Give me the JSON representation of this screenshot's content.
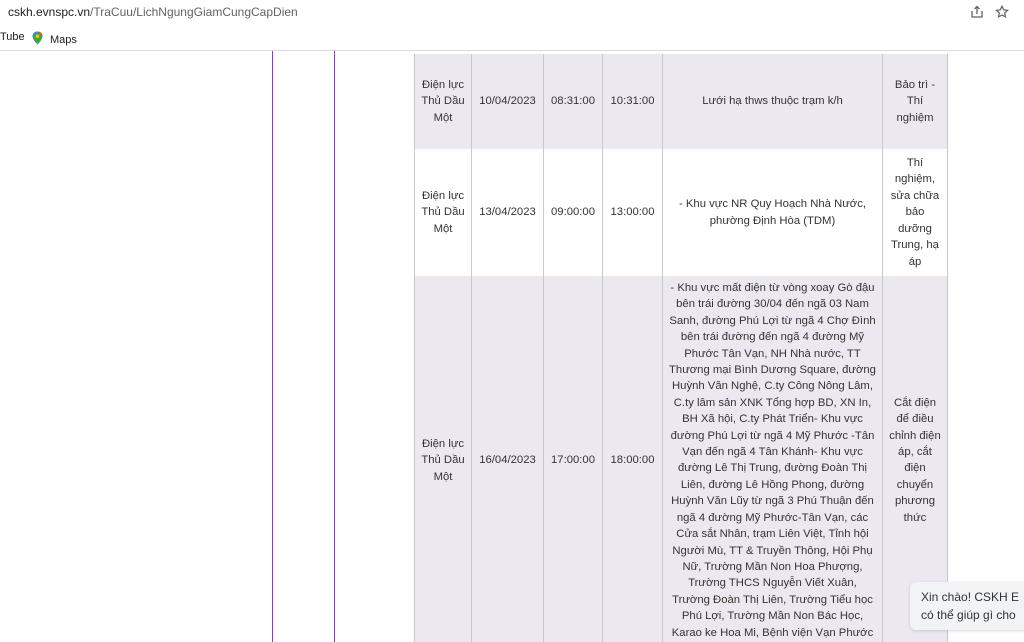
{
  "browser": {
    "url_host": "cskh.evnspc.vn",
    "url_path": "/TraCuu/LichNgungGiamCungCapDien",
    "share_icon": "share-icon",
    "bookmark_icon": "star-icon"
  },
  "bookmarks": [
    {
      "label": "Tube",
      "icon": "youtube-icon"
    },
    {
      "label": "Maps",
      "icon": "maps-icon"
    }
  ],
  "colors": {
    "purple_border": "#7b4a9e",
    "row_shade": "#ece8f0"
  },
  "schedule": {
    "rows": [
      {
        "unit": "Điện lực Thủ Dầu Một",
        "date": "10/04/2023",
        "start": "08:31:00",
        "end": "10:31:00",
        "area": "Lưới hạ thws thuộc trạm k/h",
        "reason": "Bảo trì - Thí nghiệm"
      },
      {
        "unit": "Điện lực Thủ Dầu Một",
        "date": "13/04/2023",
        "start": "09:00:00",
        "end": "13:00:00",
        "area": "- Khu vực NR Quy Hoạch Nhà Nước, phường Định Hòa (TDM)",
        "reason": "Thí nghiệm, sửa chữa bảo dưỡng Trung, hạ áp"
      },
      {
        "unit": "Điện lực Thủ Dầu Một",
        "date": "16/04/2023",
        "start": "17:00:00",
        "end": "18:00:00",
        "area": "- Khu vực mất điện từ vòng xoay Gò đậu bên trái đường 30/04 đến ngã 03 Nam Sanh, đường Phú Lợi từ ngã 4 Chợ Đình bên trái đường đến ngã 4 đường Mỹ Phước Tân Vạn, NH Nhà nước, TT Thương mại Bình Dương Square, đường Huỳnh Văn Nghệ, C.ty Công Nông Lâm, C.ty lâm sản XNK Tổng hợp BD, XN In, BH Xã hội, C.ty Phát Triển- Khu vực đường Phú Lợi từ ngã 4 Mỹ Phước -Tân Vạn đến ngã 4 Tân Khánh- Khu vực đường Lê Thị Trung, đường Đoàn Thị Liên, đường Lê Hồng Phong, đường Huỳnh Văn Lũy từ ngã 3 Phú Thuận đến ngã 4 đường Mỹ Phước-Tân Vạn, các Cửa sắt Nhân, trạm Liên Việt, Tỉnh hội Người Mù, TT & Truyền Thông, Hội Phụ Nữ, Trường Mần Non Hoa Phượng, Trường THCS Nguyễn Viết Xuân, Trường Đoàn Thị Liên, Trường Tiểu học Phú Lợi, Trường Mần Non Bác Học, Karao ke Hoa Mi, Bệnh viện Vạn Phước",
        "reason": "Cắt điện để điều chỉnh điện áp, cắt điện chuyển phương thức"
      }
    ]
  },
  "chat": {
    "line1": "Xin chào! CSKH E",
    "line2": "có thể giúp gì cho"
  }
}
